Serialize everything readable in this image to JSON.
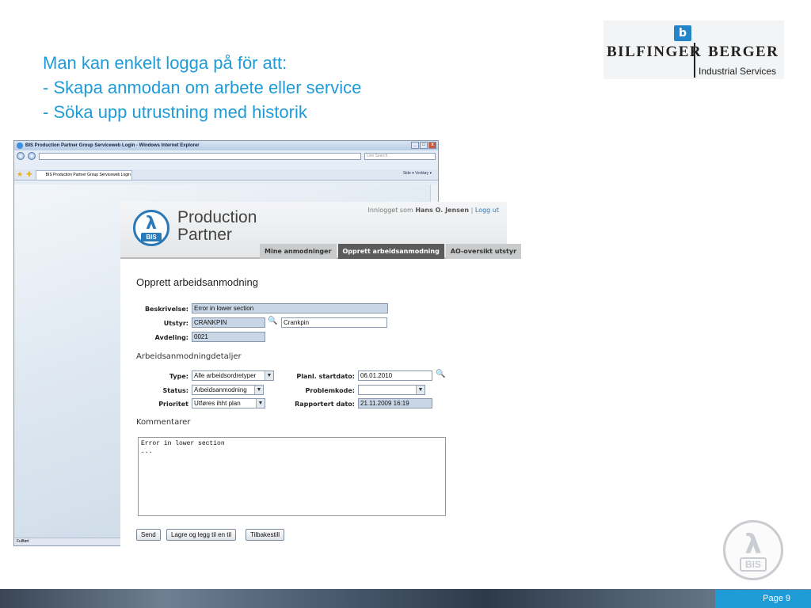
{
  "slide": {
    "heading_lines": [
      "Man kan enkelt logga på för att:",
      "- Skapa anmodan om arbete eller service",
      "- Söka upp utrustning med historik"
    ],
    "accent_color": "#1f9bd7",
    "page_label": "Page 9"
  },
  "logo": {
    "mark": "b",
    "name": "Bilfinger Berger",
    "name_left": "BILFINGER",
    "name_right": "BERGER",
    "subtitle": "Industrial Services"
  },
  "browser": {
    "window_title": "BIS Production Partner Group Serviceweb Login - Windows Internet Explorer",
    "address": "",
    "search_placeholder": "Live Search",
    "tab_title": "BIS Production Partner Group Serviceweb Login",
    "tools_text": "Side ▾  Verktøy ▾",
    "status_text": "Fullført",
    "window_buttons": [
      "_",
      "□",
      "x"
    ]
  },
  "app": {
    "brand_line1": "Production",
    "brand_line2": "Partner",
    "logo_symbol": "λ",
    "logo_text": "BIS",
    "login_prefix": "Innlogget som",
    "login_user": "Hans O. Jensen",
    "login_sep": "|",
    "logout_label": "Logg ut",
    "tabs": [
      {
        "label": "Mine anmodninger",
        "active": false
      },
      {
        "label": "Opprett arbeidsanmodning",
        "active": true
      },
      {
        "label": "AO-oversikt utstyr",
        "active": false
      }
    ],
    "page_title": "Opprett arbeidsanmodning",
    "form": {
      "description_label": "Beskrivelse:",
      "description_value": "Error in lower section",
      "equipment_label": "Utstyr:",
      "equipment_value": "CRANKPIN",
      "equipment_name": "Crankpin",
      "department_label": "Avdeling:",
      "department_value": "0021"
    },
    "details": {
      "section_title": "Arbeidsanmodningdetaljer",
      "type_label": "Type:",
      "type_value": "Alle arbeidsordretyper",
      "status_label": "Status:",
      "status_value": "Arbeidsanmodning",
      "priority_label": "Prioritet",
      "priority_value": "Utføres ihht plan",
      "start_label": "Planl. startdato:",
      "start_value": "06.01.2010",
      "problem_label": "Problemkode:",
      "problem_value": "",
      "reported_label": "Rapportert dato:",
      "reported_value": "21.11.2009 16:19"
    },
    "comments": {
      "section_title": "Kommentarer",
      "text": "Error in lower section\n..."
    },
    "buttons": {
      "send": "Send",
      "save_add": "Lagre og legg til en til",
      "reset": "Tilbakestill"
    }
  },
  "watermark": {
    "symbol": "λ",
    "text": "BIS"
  }
}
